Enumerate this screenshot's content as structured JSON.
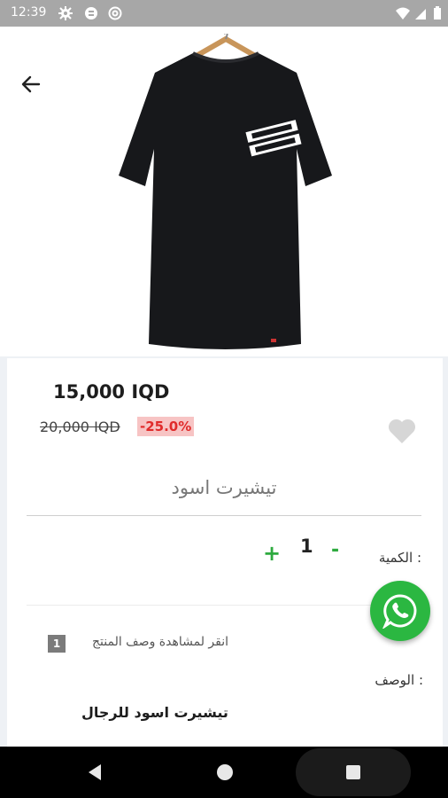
{
  "status_bar": {
    "time": "12:39"
  },
  "product": {
    "price": "15,000 IQD",
    "old_price": "20,000 IQD",
    "discount": "-25.0%",
    "name": "تيشيرت اسود"
  },
  "quantity": {
    "label": "الكمية :",
    "minus": "-",
    "value": "1",
    "plus": "+"
  },
  "description": {
    "toggle_number": "1",
    "toggle_label": "انقر لمشاهدة وصف المنتج",
    "label": "الوصف :",
    "text": "تيشيرت اسود للرجال"
  },
  "colors": {
    "accent_green": "#2eaa3f",
    "discount_red": "#e02b2b",
    "whatsapp_green": "#2bb741"
  },
  "icons": [
    "back-arrow-icon",
    "heart-icon",
    "whatsapp-icon",
    "settings-icon",
    "wifi-icon",
    "battery-icon"
  ]
}
